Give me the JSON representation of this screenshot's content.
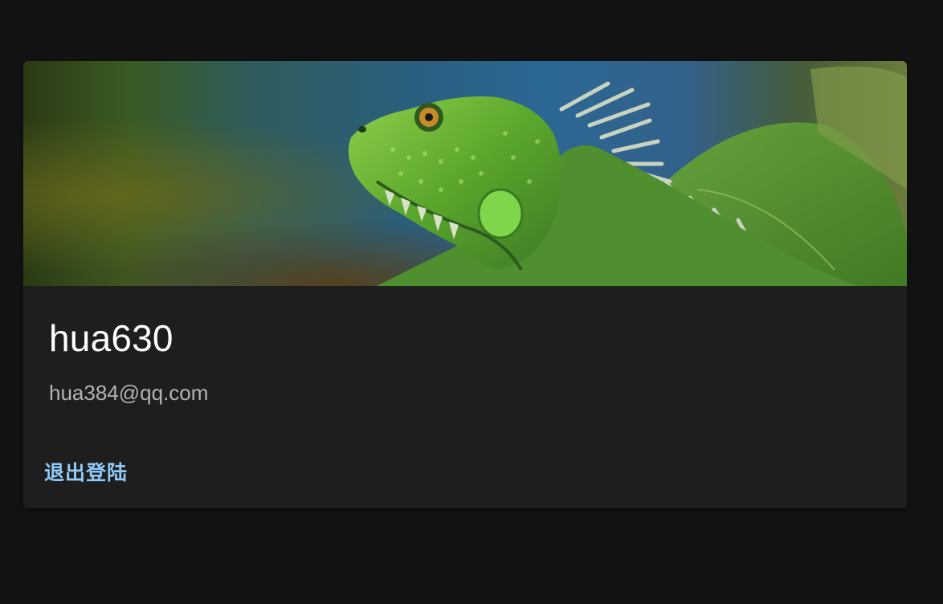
{
  "profile": {
    "username": "hua630",
    "email": "hua384@qq.com"
  },
  "actions": {
    "logout_label": "退出登陆"
  },
  "media": {
    "icon": "iguana-photo"
  },
  "colors": {
    "background": "#121212",
    "card": "#1e1e1e",
    "accent": "#90caf9"
  }
}
